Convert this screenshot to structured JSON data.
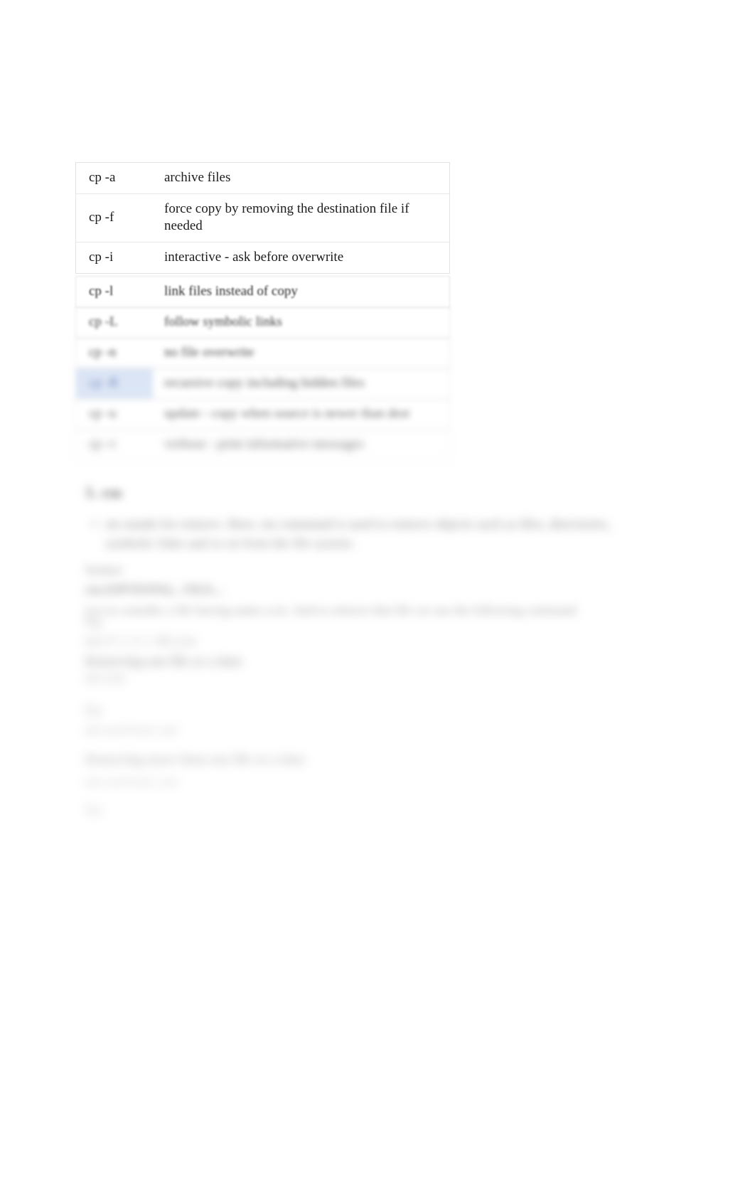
{
  "document": {
    "table": {
      "rows": [
        {
          "flag": "cp -a",
          "desc": "archive files",
          "highlight": false
        },
        {
          "flag": "cp -f",
          "desc": "force copy by removing the destination file if needed",
          "highlight": false
        },
        {
          "flag": "cp -i",
          "desc": "interactive - ask before overwrite",
          "highlight": false
        },
        {
          "flag": "cp -l",
          "desc": "link files instead of copy",
          "highlight": false
        },
        {
          "flag": "cp -L",
          "desc": "follow symbolic links",
          "highlight": false
        },
        {
          "flag": "cp -n",
          "desc": "no file overwrite",
          "highlight": false
        },
        {
          "flag": "cp -R",
          "desc": "recursive copy including hidden files",
          "highlight": true
        },
        {
          "flag": "cp -u",
          "desc": "update - copy when source is newer than dest",
          "highlight": false
        },
        {
          "flag": "cp -v",
          "desc": "verbose - print informative messages",
          "highlight": false
        }
      ]
    },
    "section": {
      "heading": "5.  rm",
      "intro": "rm stands for remove. Here, rm command is used to remove objects such as files, directories, symbolic links and so on from the file system.",
      "syntax_label": "Syntax:",
      "syntax_code": "rm [OPTIONS]... FILE...",
      "syntax_note": "Let us consider a file having name a.txt. And to remove that file we use the following command",
      "eg1_label": "Eg:",
      "eg1_code": "rm [-f -i -I -r -R] a.txt",
      "note1": "Removing one file at a time",
      "plain1": "rm a.txt",
      "eg2_label": "Eg:",
      "eg2_code": "rm a.txt b.txt c.txt",
      "note2": "Removing more than one file at a time",
      "trailing_code": "rm a.txt b.txt c.txt",
      "trailing_label": "Eg:"
    }
  }
}
